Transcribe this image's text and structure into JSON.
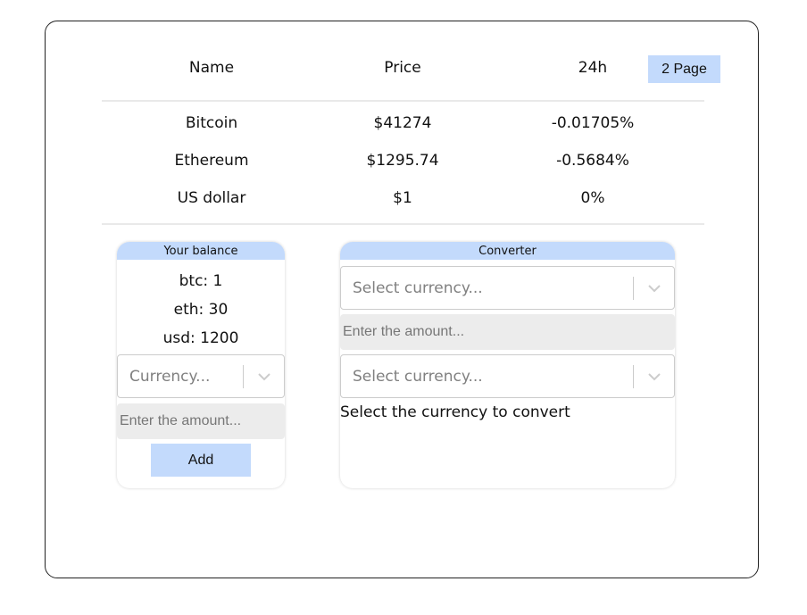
{
  "table": {
    "headers": {
      "name": "Name",
      "price": "Price",
      "change": "24h"
    },
    "page_button": "2 Page",
    "rows": [
      {
        "name": "Bitcoin",
        "price": "$41274",
        "change": "-0.01705%"
      },
      {
        "name": "Ethereum",
        "price": "$1295.74",
        "change": "-0.5684%"
      },
      {
        "name": "US dollar",
        "price": "$1",
        "change": "0%"
      }
    ]
  },
  "balance": {
    "title": "Your balance",
    "lines": [
      "btc: 1",
      "eth: 30",
      "usd: 1200"
    ],
    "currency_placeholder": "Currency...",
    "amount_placeholder": "Enter the amount...",
    "add_label": "Add"
  },
  "converter": {
    "title": "Converter",
    "from_placeholder": "Select currency...",
    "amount_placeholder": "Enter the amount...",
    "to_placeholder": "Select currency...",
    "result_text": "Select the currency to convert"
  },
  "colors": {
    "accent": "#c3dafc",
    "input_bg": "#ececec",
    "border": "#cccccc"
  },
  "icons": {
    "dropdown": "chevron-down-icon"
  }
}
